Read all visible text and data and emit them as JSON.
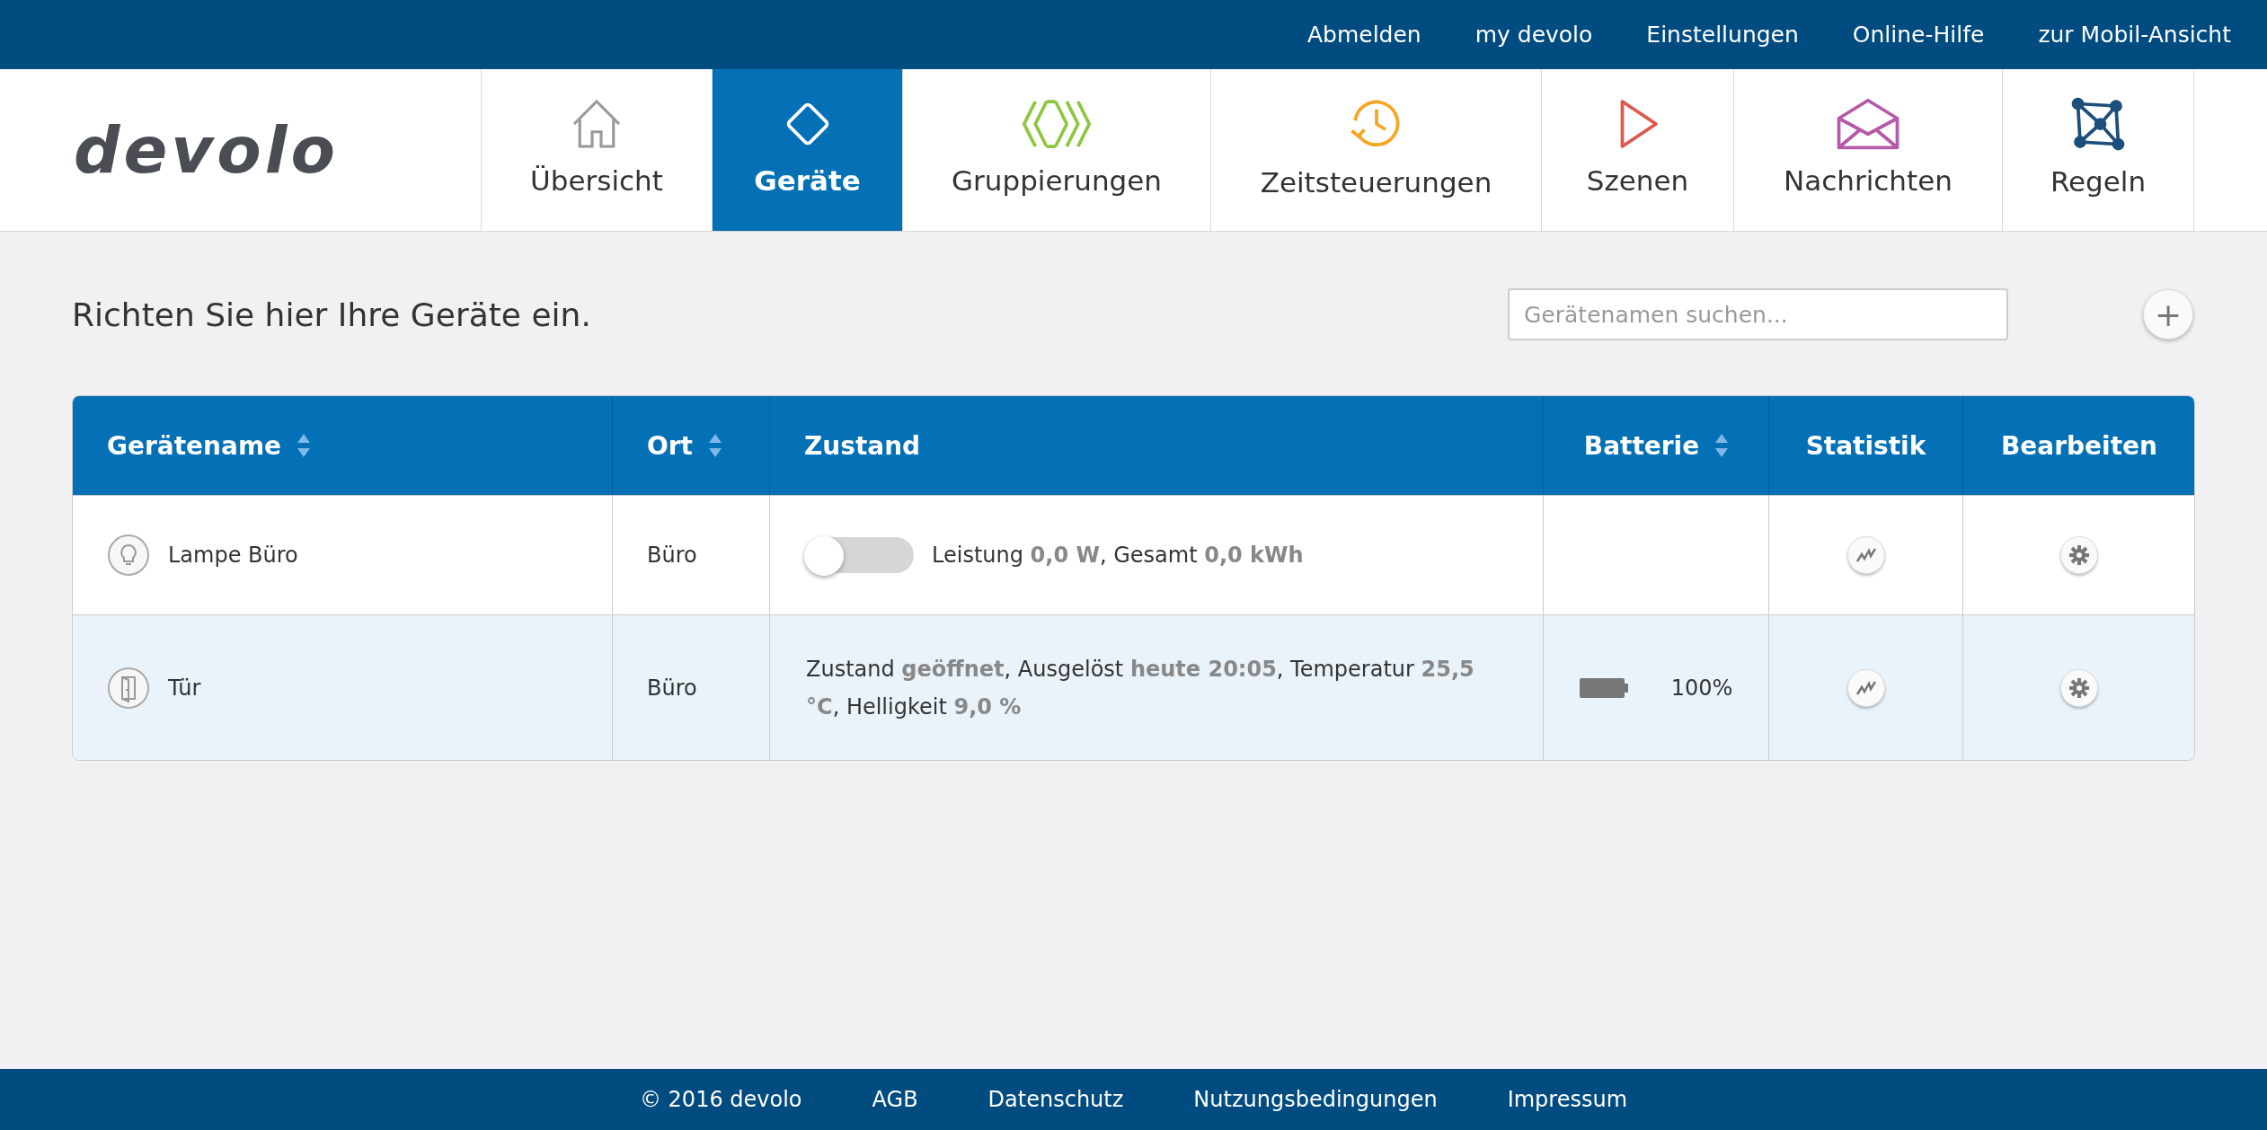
{
  "top_links": [
    "Abmelden",
    "my devolo",
    "Einstellungen",
    "Online-Hilfe",
    "zur Mobil-Ansicht"
  ],
  "logo": "devolo",
  "nav": [
    {
      "label": "Übersicht",
      "selected": false
    },
    {
      "label": "Geräte",
      "selected": true
    },
    {
      "label": "Gruppierungen",
      "selected": false
    },
    {
      "label": "Zeitsteuerungen",
      "selected": false
    },
    {
      "label": "Szenen",
      "selected": false
    },
    {
      "label": "Nachrichten",
      "selected": false
    },
    {
      "label": "Regeln",
      "selected": false
    }
  ],
  "heading": "Richten Sie hier Ihre Geräte ein.",
  "search": {
    "placeholder": "Gerätenamen suchen..."
  },
  "add_button": "+",
  "table": {
    "columns": [
      {
        "label": "Gerätename",
        "sortable": true
      },
      {
        "label": "Ort",
        "sortable": true
      },
      {
        "label": "Zustand",
        "sortable": false
      },
      {
        "label": "Batterie",
        "sortable": true
      },
      {
        "label": "Statistik",
        "sortable": false
      },
      {
        "label": "Bearbeiten",
        "sortable": false
      }
    ],
    "rows": [
      {
        "kind": "lamp",
        "name": "Lampe Büro",
        "location": "Büro",
        "switch": {
          "on": false
        },
        "status": "Leistung **0,0 W**, Gesamt **0,0 kWh**"
      },
      {
        "kind": "door",
        "name": "Tür",
        "location": "Büro",
        "status": "Zustand **geöffnet**, Ausgelöst **heute 20:05**, Temperatur **25,5 °C**, Helligkeit **9,0 %**",
        "battery": {
          "level": 1,
          "reading": "100%"
        }
      }
    ]
  },
  "footer": [
    "© 2016 devolo",
    "AGB",
    "Datenschutz",
    "Nutzungsbedingungen",
    "Impressum"
  ]
}
